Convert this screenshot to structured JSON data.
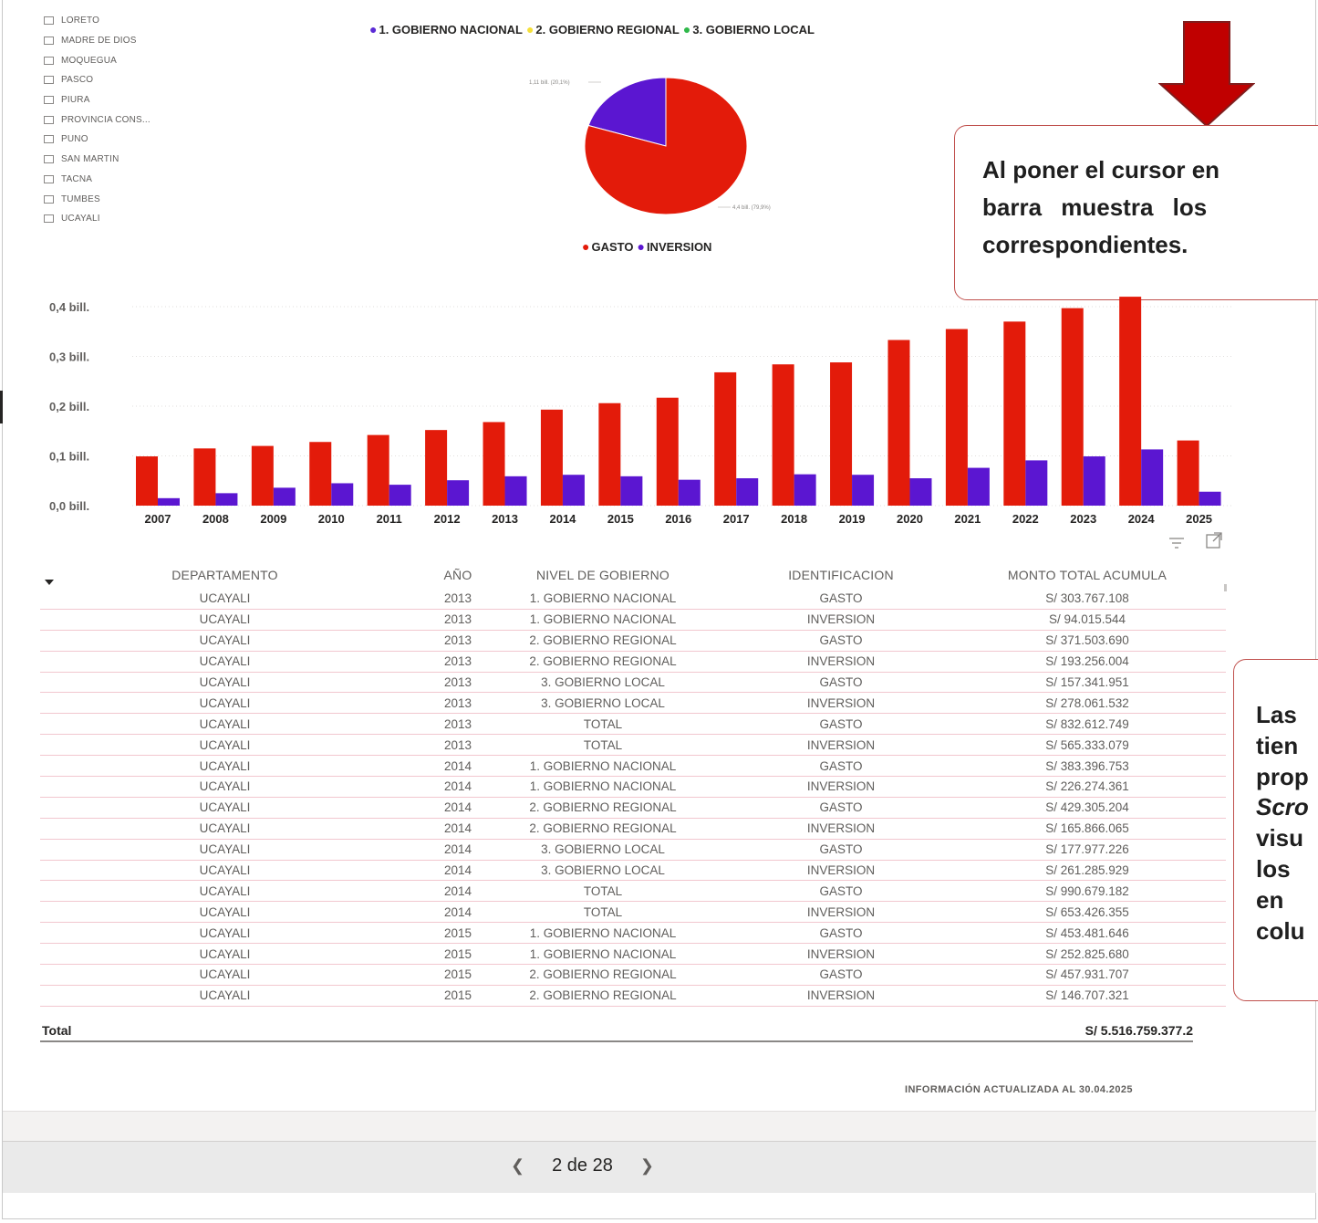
{
  "slicer": {
    "items": [
      "LORETO",
      "MADRE DE DIOS",
      "MOQUEGUA",
      "PASCO",
      "PIURA",
      "PROVINCIA CONS...",
      "PUNO",
      "SAN MARTIN",
      "TACNA",
      "TUMBES",
      "UCAYALI"
    ]
  },
  "legend_top": {
    "items": [
      {
        "label": "1. GOBIERNO NACIONAL",
        "color": "#5b2bd6"
      },
      {
        "label": "2. GOBIERNO REGIONAL",
        "color": "#f5e03a"
      },
      {
        "label": "3. GOBIERNO LOCAL",
        "color": "#2fb84a"
      }
    ]
  },
  "pie": {
    "label_inversion": "1,11 bill. (20,1%)",
    "label_gasto": "4,4 bill. (79,9%)",
    "legend": [
      {
        "label": "GASTO",
        "color": "#e31b0a"
      },
      {
        "label": "INVERSION",
        "color": "#5b16d1"
      }
    ]
  },
  "callout_top": {
    "lines": [
      "Al poner el cursor en",
      "barra muestra los",
      "correspondientes."
    ]
  },
  "callout_right": {
    "lines": [
      "Las",
      "tien",
      "prop",
      "Scro",
      "visu",
      "los",
      "en",
      "colu"
    ]
  },
  "chart_data": [
    {
      "type": "pie",
      "categories": [
        "GASTO",
        "INVERSION"
      ],
      "values": [
        4.4,
        1.11
      ],
      "percent": [
        79.9,
        20.1
      ],
      "colors": [
        "#e31b0a",
        "#5b16d1"
      ]
    },
    {
      "type": "bar",
      "categories": [
        "2007",
        "2008",
        "2009",
        "2010",
        "2011",
        "2012",
        "2013",
        "2014",
        "2015",
        "2016",
        "2017",
        "2018",
        "2019",
        "2020",
        "2021",
        "2022",
        "2023",
        "2024",
        "2025"
      ],
      "series": [
        {
          "name": "GASTO",
          "color": "#e31b0a",
          "values": [
            0.099,
            0.115,
            0.12,
            0.128,
            0.142,
            0.152,
            0.168,
            0.193,
            0.206,
            0.217,
            0.268,
            0.284,
            0.288,
            0.333,
            0.355,
            0.37,
            0.397,
            0.42,
            0.131
          ]
        },
        {
          "name": "INVERSION",
          "color": "#5b16d1",
          "values": [
            0.015,
            0.025,
            0.036,
            0.045,
            0.042,
            0.051,
            0.059,
            0.062,
            0.059,
            0.052,
            0.055,
            0.063,
            0.062,
            0.055,
            0.076,
            0.091,
            0.099,
            0.113,
            0.028
          ]
        }
      ],
      "yticks": [
        "0,0 bill.",
        "0,1 bill.",
        "0,2 bill.",
        "0,3 bill.",
        "0,4 bill."
      ],
      "ylim": [
        0,
        0.4
      ],
      "grid": true
    }
  ],
  "table": {
    "headers": [
      "DEPARTAMENTO",
      "AÑO",
      "NIVEL DE GOBIERNO",
      "IDENTIFICACION",
      "MONTO TOTAL ACUMULA"
    ],
    "rows": [
      [
        "UCAYALI",
        "2013",
        "1. GOBIERNO NACIONAL",
        "GASTO",
        "S/ 303.767.108"
      ],
      [
        "UCAYALI",
        "2013",
        "1. GOBIERNO NACIONAL",
        "INVERSION",
        "S/ 94.015.544"
      ],
      [
        "UCAYALI",
        "2013",
        "2. GOBIERNO REGIONAL",
        "GASTO",
        "S/ 371.503.690"
      ],
      [
        "UCAYALI",
        "2013",
        "2. GOBIERNO REGIONAL",
        "INVERSION",
        "S/ 193.256.004"
      ],
      [
        "UCAYALI",
        "2013",
        "3. GOBIERNO LOCAL",
        "GASTO",
        "S/ 157.341.951"
      ],
      [
        "UCAYALI",
        "2013",
        "3. GOBIERNO LOCAL",
        "INVERSION",
        "S/ 278.061.532"
      ],
      [
        "UCAYALI",
        "2013",
        "TOTAL",
        "GASTO",
        "S/ 832.612.749"
      ],
      [
        "UCAYALI",
        "2013",
        "TOTAL",
        "INVERSION",
        "S/ 565.333.079"
      ],
      [
        "UCAYALI",
        "2014",
        "1. GOBIERNO NACIONAL",
        "GASTO",
        "S/ 383.396.753"
      ],
      [
        "UCAYALI",
        "2014",
        "1. GOBIERNO NACIONAL",
        "INVERSION",
        "S/ 226.274.361"
      ],
      [
        "UCAYALI",
        "2014",
        "2. GOBIERNO REGIONAL",
        "GASTO",
        "S/ 429.305.204"
      ],
      [
        "UCAYALI",
        "2014",
        "2. GOBIERNO REGIONAL",
        "INVERSION",
        "S/ 165.866.065"
      ],
      [
        "UCAYALI",
        "2014",
        "3. GOBIERNO LOCAL",
        "GASTO",
        "S/ 177.977.226"
      ],
      [
        "UCAYALI",
        "2014",
        "3. GOBIERNO LOCAL",
        "INVERSION",
        "S/ 261.285.929"
      ],
      [
        "UCAYALI",
        "2014",
        "TOTAL",
        "GASTO",
        "S/ 990.679.182"
      ],
      [
        "UCAYALI",
        "2014",
        "TOTAL",
        "INVERSION",
        "S/ 653.426.355"
      ],
      [
        "UCAYALI",
        "2015",
        "1. GOBIERNO NACIONAL",
        "GASTO",
        "S/ 453.481.646"
      ],
      [
        "UCAYALI",
        "2015",
        "1. GOBIERNO NACIONAL",
        "INVERSION",
        "S/ 252.825.680"
      ],
      [
        "UCAYALI",
        "2015",
        "2. GOBIERNO REGIONAL",
        "GASTO",
        "S/ 457.931.707"
      ],
      [
        "UCAYALI",
        "2015",
        "2. GOBIERNO REGIONAL",
        "INVERSION",
        "S/ 146.707.321"
      ]
    ],
    "total_label": "Total",
    "total_value": "S/ 5.516.759.377.2"
  },
  "footer": {
    "updated": "INFORMACIÓN ACTUALIZADA AL 30.04.2025"
  },
  "pager": {
    "label": "2 de 28"
  },
  "icons": {
    "filter": "filter-icon",
    "focus": "focus-mode-icon",
    "sort": "sort-desc-icon",
    "prev": "chevron-left-icon",
    "next": "chevron-right-icon"
  }
}
